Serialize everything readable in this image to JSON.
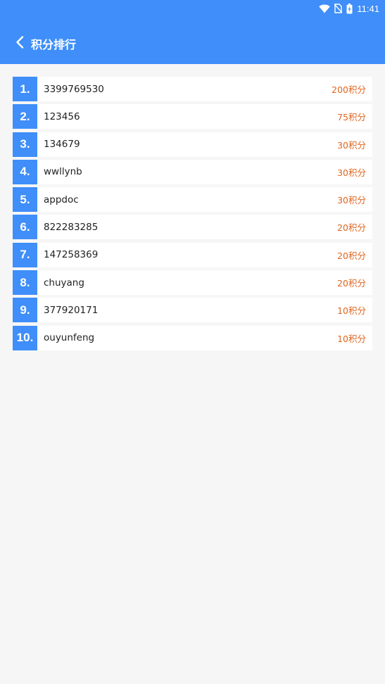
{
  "status_bar": {
    "time": "11:41",
    "icons": [
      "wifi-icon",
      "no-sim-icon",
      "battery-charging-icon"
    ]
  },
  "header": {
    "back_icon": "chevron-left-icon",
    "title": "积分排行"
  },
  "colors": {
    "primary": "#3f8ef9",
    "points": "#e0651e",
    "background": "#f6f6f6"
  },
  "ranking": [
    {
      "rank": "1.",
      "name": "3399769530",
      "points": "200积分"
    },
    {
      "rank": "2.",
      "name": "123456",
      "points": "75积分"
    },
    {
      "rank": "3.",
      "name": "134679",
      "points": "30积分"
    },
    {
      "rank": "4.",
      "name": "wwllynb",
      "points": "30积分"
    },
    {
      "rank": "5.",
      "name": "appdoc",
      "points": "30积分"
    },
    {
      "rank": "6.",
      "name": "822283285",
      "points": "20积分"
    },
    {
      "rank": "7.",
      "name": "147258369",
      "points": "20积分"
    },
    {
      "rank": "8.",
      "name": "chuyang",
      "points": "20积分"
    },
    {
      "rank": "9.",
      "name": "377920171",
      "points": "10积分"
    },
    {
      "rank": "10.",
      "name": "ouyunfeng",
      "points": "10积分"
    }
  ]
}
